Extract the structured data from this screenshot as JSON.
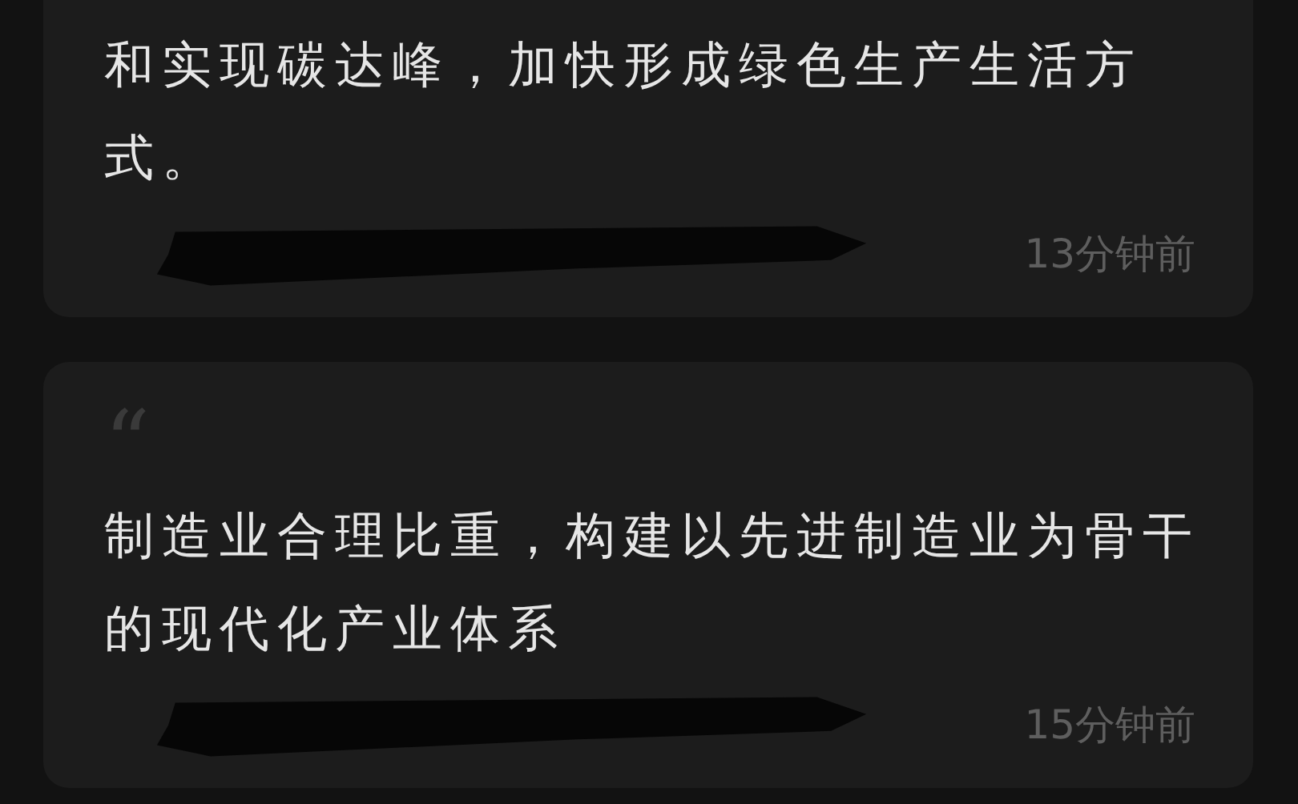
{
  "posts": [
    {
      "text": "和实现碳达峰，加快形成绿色生产生活方式。",
      "time": "13分钟前"
    },
    {
      "quote_mark": "“",
      "text": "制造业合理比重，构建以先进制造业为骨干的现代化产业体系",
      "time": "15分钟前"
    }
  ]
}
